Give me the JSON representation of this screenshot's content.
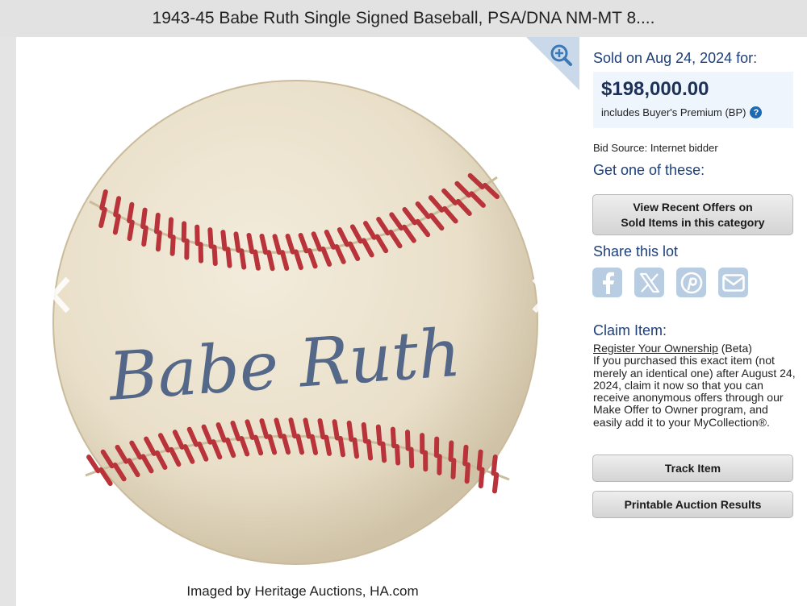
{
  "title": "1943-45 Babe Ruth Single Signed Baseball, PSA/DNA NM-MT 8....",
  "image": {
    "signature": "Babe Ruth",
    "credit": "Imaged by Heritage Auctions, HA.com",
    "zoom_icon": "zoom-in-icon",
    "prev_icon": "chevron-left-icon",
    "next_icon": "chevron-right-icon"
  },
  "sale": {
    "sold_label": "Sold on Aug 24, 2024 for:",
    "price": "$198,000.00",
    "premium_note": "includes Buyer's Premium (BP)",
    "help_symbol": "?",
    "bid_source": "Bid Source: Internet bidder"
  },
  "offers": {
    "heading": "Get one of these:",
    "button_line1": "View Recent Offers on",
    "button_line2": "Sold Items in this category"
  },
  "share": {
    "heading": "Share this lot",
    "icons": [
      "facebook-icon",
      "x-icon",
      "pinterest-icon",
      "email-icon"
    ]
  },
  "claim": {
    "heading": "Claim Item:",
    "link_text": "Register Your Ownership",
    "beta": " (Beta)",
    "body": "If you purchased this exact item (not merely an identical one) after August 24, 2024, claim it now so that you can receive anonymous offers through our Make Offer to Owner program, and easily add it to your MyCollection®."
  },
  "actions": {
    "track": "Track Item",
    "print": "Printable Auction Results"
  },
  "colors": {
    "heading_blue": "#1d3f7a",
    "price_box": "#eef5fc",
    "share_icon_bg": "#b8cde2",
    "seam_red": "#b8343a",
    "ink_blue": "#40577f"
  }
}
